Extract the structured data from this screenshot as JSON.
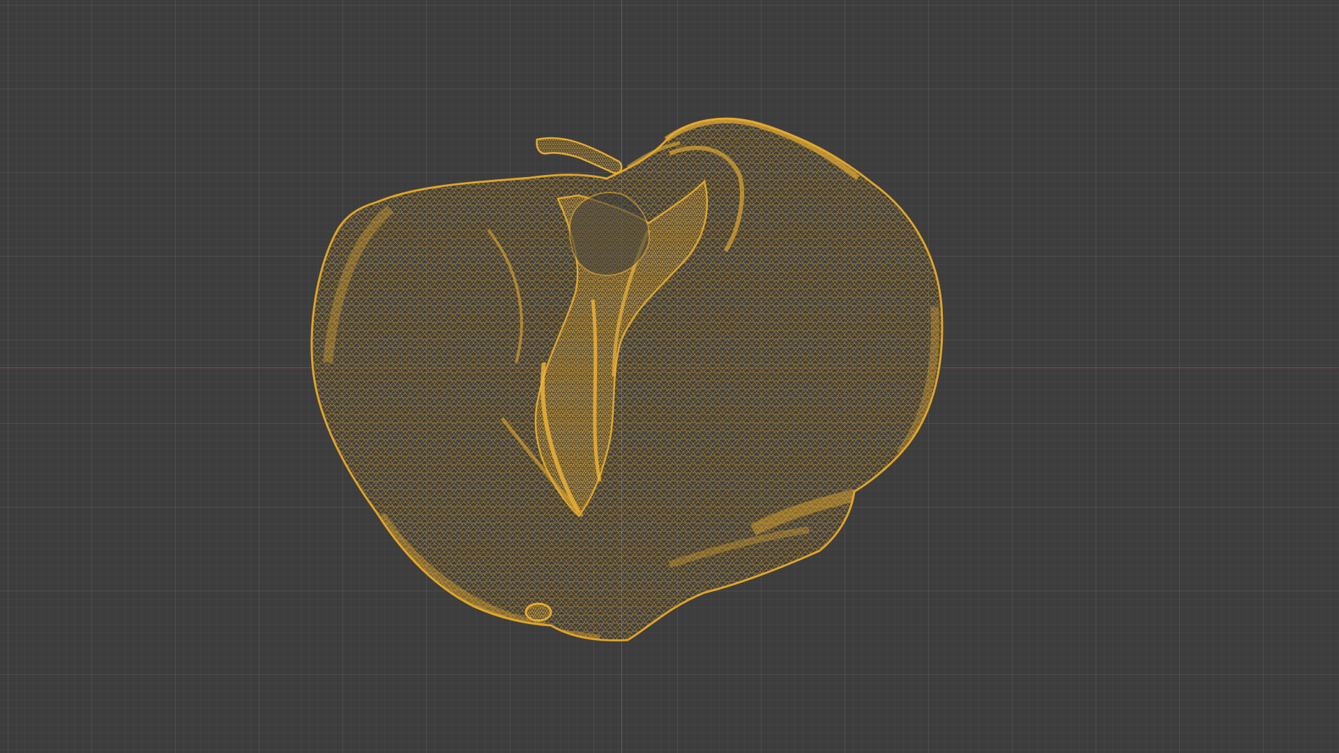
{
  "viewport": {
    "name": "3D viewport",
    "background_color": "#3d3d3d",
    "grid_color": "#4a4a4a",
    "x_axis_color": "#8a4a4a",
    "y_axis_color": "#4a6a95"
  },
  "mesh": {
    "display_mode": "wireframe",
    "wire_color": "#e0a52a",
    "selected": true,
    "object": "organic-scan-mesh"
  }
}
